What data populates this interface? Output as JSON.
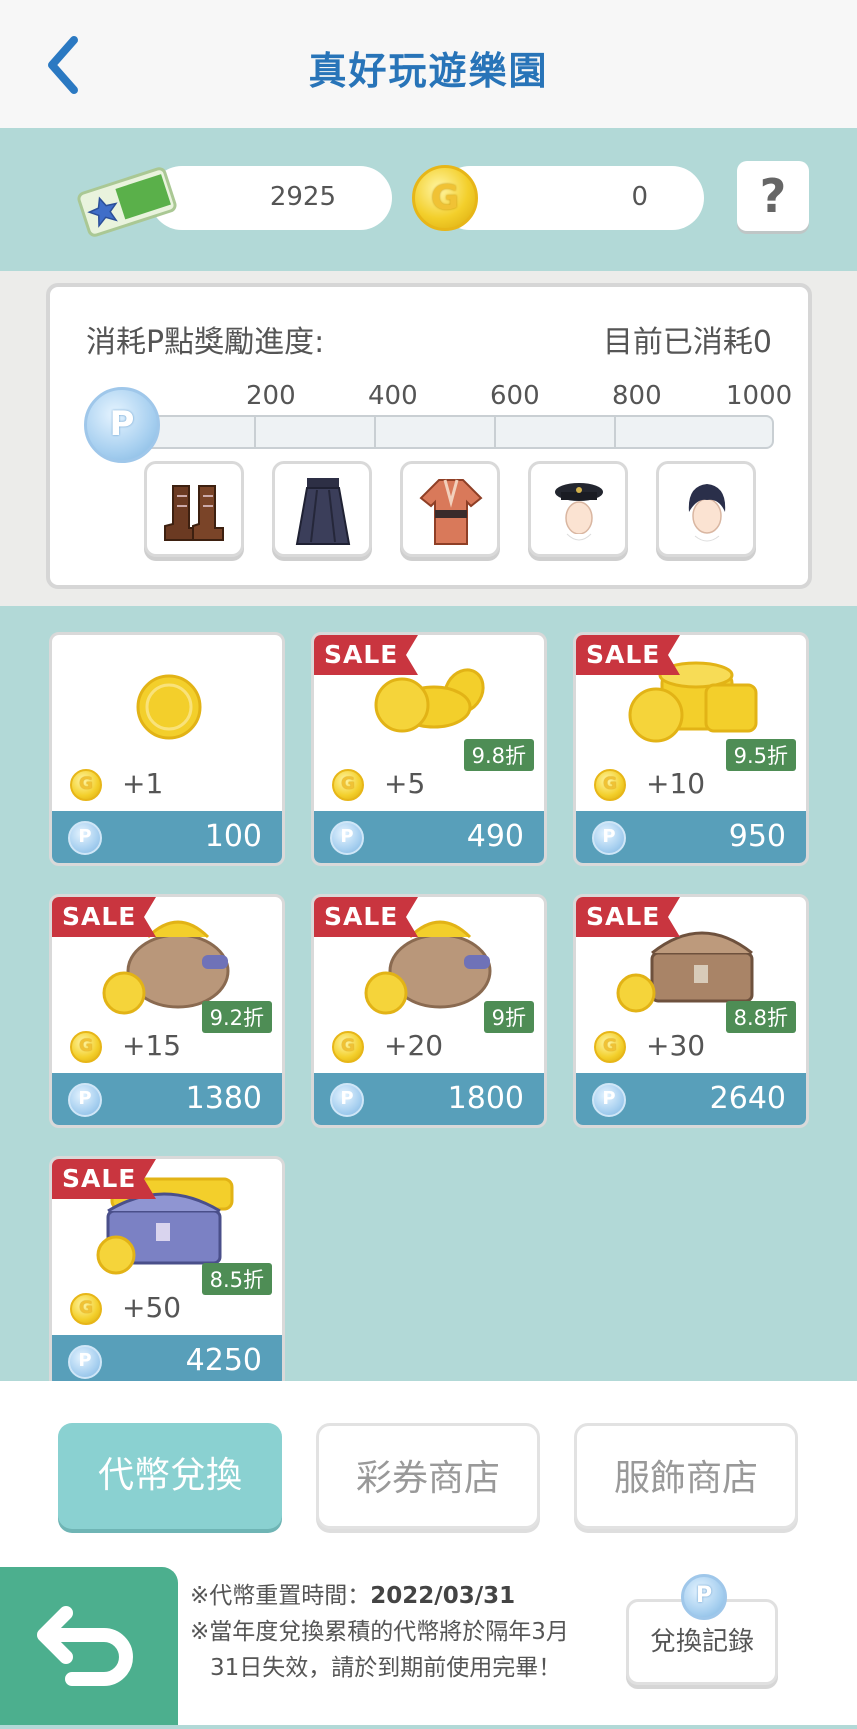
{
  "header": {
    "title": "真好玩遊樂園"
  },
  "currency": {
    "tickets": "2925",
    "g_coins": "0",
    "g_symbol": "G",
    "help": "?"
  },
  "progress": {
    "label": "消耗P點獎勵進度:",
    "used_text": "目前已消耗0",
    "p_symbol": "P",
    "ticks": [
      "200",
      "400",
      "600",
      "800",
      "1000"
    ],
    "fill_fraction": 0,
    "rewards": [
      "boots-icon",
      "hakama-icon",
      "kimono-icon",
      "officer-cap-icon",
      "hairstyle-icon"
    ]
  },
  "products": [
    {
      "qty": "+1",
      "price": "100",
      "sale": "",
      "discount": ""
    },
    {
      "qty": "+5",
      "price": "490",
      "sale": "SALE",
      "discount": "9.8折"
    },
    {
      "qty": "+10",
      "price": "950",
      "sale": "SALE",
      "discount": "9.5折"
    },
    {
      "qty": "+15",
      "price": "1380",
      "sale": "SALE",
      "discount": "9.2折"
    },
    {
      "qty": "+20",
      "price": "1800",
      "sale": "SALE",
      "discount": "9折"
    },
    {
      "qty": "+30",
      "price": "2640",
      "sale": "SALE",
      "discount": "8.8折"
    },
    {
      "qty": "+50",
      "price": "4250",
      "sale": "SALE",
      "discount": "8.5折"
    }
  ],
  "tabs": [
    "代幣兌換",
    "彩券商店",
    "服飾商店"
  ],
  "footer": {
    "note1_prefix": "※代幣重置時間：",
    "note1_date": "2022/03/31",
    "note2": "※當年度兌換累積的代幣將於隔年3月",
    "note3": "31日失效，請於到期前使用完畢！",
    "history_label": "兌換記錄"
  },
  "colors": {
    "accent": "#8ad1d1",
    "title": "#2874b8",
    "price_bar": "#589fba",
    "sale": "#c9353f",
    "discount": "#4e8d55",
    "return": "#4caf8e"
  }
}
